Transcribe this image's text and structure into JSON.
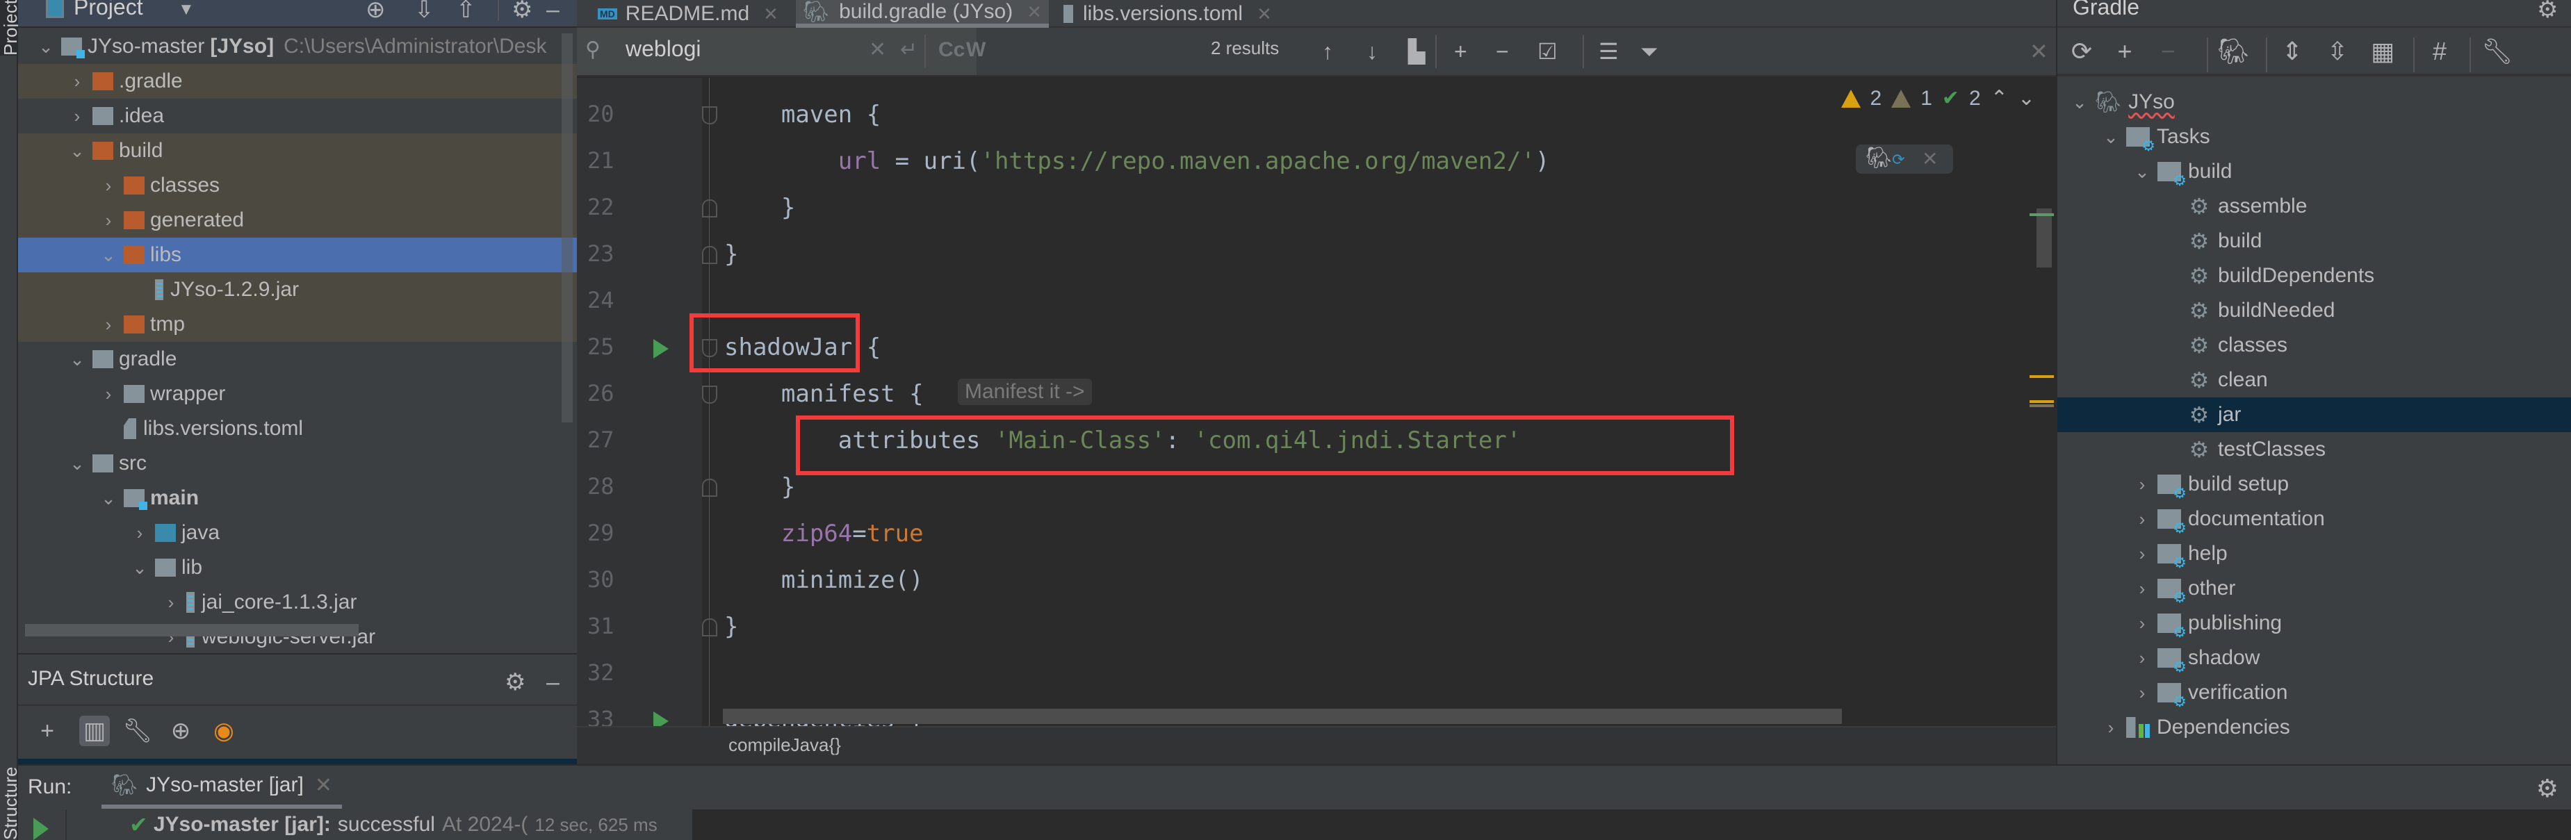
{
  "left_strip": {
    "project_label": "Project",
    "structure_label": "Structure"
  },
  "project_panel": {
    "title": "Project",
    "tree": [
      {
        "label": "JYso-master",
        "bold_suffix": "[JYso]",
        "path": "C:\\Users\\Administrator\\Desk",
        "depth": 0,
        "expanded": true,
        "icon": "module-folder"
      },
      {
        "label": ".gradle",
        "depth": 1,
        "expanded": false,
        "icon": "excluded-folder",
        "excluded": true
      },
      {
        "label": ".idea",
        "depth": 1,
        "expanded": false,
        "icon": "folder"
      },
      {
        "label": "build",
        "depth": 1,
        "expanded": true,
        "icon": "excluded-folder",
        "excluded": true
      },
      {
        "label": "classes",
        "depth": 2,
        "expanded": false,
        "icon": "excluded-folder",
        "excluded": true
      },
      {
        "label": "generated",
        "depth": 2,
        "expanded": false,
        "icon": "excluded-folder",
        "excluded": true
      },
      {
        "label": "libs",
        "depth": 2,
        "expanded": true,
        "icon": "excluded-folder",
        "selected": true
      },
      {
        "label": "JYso-1.2.9.jar",
        "depth": 3,
        "icon": "jar",
        "excluded": true
      },
      {
        "label": "tmp",
        "depth": 2,
        "expanded": false,
        "icon": "excluded-folder",
        "excluded": true
      },
      {
        "label": "gradle",
        "depth": 1,
        "expanded": true,
        "icon": "folder"
      },
      {
        "label": "wrapper",
        "depth": 2,
        "expanded": false,
        "icon": "folder"
      },
      {
        "label": "libs.versions.toml",
        "depth": 2,
        "icon": "file"
      },
      {
        "label": "src",
        "depth": 1,
        "expanded": true,
        "icon": "folder"
      },
      {
        "label": "main",
        "depth": 2,
        "expanded": true,
        "icon": "module-folder",
        "bold": true
      },
      {
        "label": "java",
        "depth": 3,
        "expanded": false,
        "icon": "source-folder"
      },
      {
        "label": "lib",
        "depth": 3,
        "expanded": true,
        "icon": "folder"
      },
      {
        "label": "jai_core-1.1.3.jar",
        "depth": 4,
        "expanded": false,
        "icon": "jar"
      },
      {
        "label": "weblogic-server.jar",
        "depth": 4,
        "expanded": false,
        "icon": "jar"
      }
    ]
  },
  "jpa_panel": {
    "title": "JPA Structure"
  },
  "editor": {
    "tabs": [
      {
        "label": "README.md",
        "icon": "markdown-icon",
        "active": false
      },
      {
        "label": "build.gradle (JYso)",
        "icon": "gradle-icon",
        "active": true
      },
      {
        "label": "libs.versions.toml",
        "icon": "file-icon",
        "active": false
      }
    ],
    "find": {
      "query": "weblogi",
      "result_count": "2 results",
      "match_case": "Cc",
      "words": "W",
      "regex": ".*"
    },
    "inspections": {
      "warnings": "2",
      "weak_warnings": "1",
      "typos": "2"
    },
    "lines": [
      {
        "no": "20",
        "parts": [
          [
            "plain",
            "    maven {"
          ]
        ]
      },
      {
        "no": "21",
        "parts": [
          [
            "plain",
            "        "
          ],
          [
            "prop",
            "url"
          ],
          [
            "plain",
            " = uri("
          ],
          [
            "str",
            "'https://repo.maven.apache.org/maven2/'"
          ],
          [
            "plain",
            ")"
          ]
        ]
      },
      {
        "no": "22",
        "parts": [
          [
            "plain",
            "    }"
          ]
        ]
      },
      {
        "no": "23",
        "parts": [
          [
            "plain",
            "}"
          ]
        ]
      },
      {
        "no": "24",
        "parts": []
      },
      {
        "no": "25",
        "parts": [
          [
            "plain",
            "shadowJar {"
          ]
        ]
      },
      {
        "no": "26",
        "parts": [
          [
            "plain",
            "    manifest {"
          ]
        ]
      },
      {
        "no": "27",
        "parts": [
          [
            "plain",
            "        attributes "
          ],
          [
            "str",
            "'Main-Class'"
          ],
          [
            "plain",
            ": "
          ],
          [
            "str",
            "'com.qi4l.jndi.Starter'"
          ]
        ]
      },
      {
        "no": "28",
        "parts": [
          [
            "plain",
            "    }"
          ]
        ]
      },
      {
        "no": "29",
        "parts": [
          [
            "plain",
            "    "
          ],
          [
            "prop",
            "zip64"
          ],
          [
            "plain",
            "="
          ],
          [
            "kw",
            "true"
          ]
        ]
      },
      {
        "no": "30",
        "parts": [
          [
            "plain",
            "    minimize()"
          ]
        ]
      },
      {
        "no": "31",
        "parts": [
          [
            "plain",
            "}"
          ]
        ]
      },
      {
        "no": "32",
        "parts": []
      },
      {
        "no": "33",
        "parts": [
          [
            "plain",
            "dependencies {"
          ]
        ]
      }
    ],
    "inlay_hint": "Manifest it ->",
    "breadcrumb": "compileJava{}"
  },
  "gradle_panel": {
    "title": "Gradle",
    "tree": [
      {
        "label": "JYso",
        "depth": 0,
        "expanded": true,
        "icon": "elephant",
        "squiggle": true
      },
      {
        "label": "Tasks",
        "depth": 1,
        "expanded": true,
        "icon": "task-folder"
      },
      {
        "label": "build",
        "depth": 2,
        "expanded": true,
        "icon": "task-folder"
      },
      {
        "label": "assemble",
        "depth": 3,
        "icon": "gear"
      },
      {
        "label": "build",
        "depth": 3,
        "icon": "gear"
      },
      {
        "label": "buildDependents",
        "depth": 3,
        "icon": "gear"
      },
      {
        "label": "buildNeeded",
        "depth": 3,
        "icon": "gear"
      },
      {
        "label": "classes",
        "depth": 3,
        "icon": "gear"
      },
      {
        "label": "clean",
        "depth": 3,
        "icon": "gear"
      },
      {
        "label": "jar",
        "depth": 3,
        "icon": "gear",
        "selected": true
      },
      {
        "label": "testClasses",
        "depth": 3,
        "icon": "gear"
      },
      {
        "label": "build setup",
        "depth": 2,
        "expanded": false,
        "icon": "task-folder"
      },
      {
        "label": "documentation",
        "depth": 2,
        "expanded": false,
        "icon": "task-folder"
      },
      {
        "label": "help",
        "depth": 2,
        "expanded": false,
        "icon": "task-folder"
      },
      {
        "label": "other",
        "depth": 2,
        "expanded": false,
        "icon": "task-folder"
      },
      {
        "label": "publishing",
        "depth": 2,
        "expanded": false,
        "icon": "task-folder"
      },
      {
        "label": "shadow",
        "depth": 2,
        "expanded": false,
        "icon": "task-folder"
      },
      {
        "label": "verification",
        "depth": 2,
        "expanded": false,
        "icon": "task-folder"
      },
      {
        "label": "Dependencies",
        "depth": 1,
        "expanded": false,
        "icon": "dependencies"
      }
    ]
  },
  "run_panel": {
    "label": "Run:",
    "tab": "JYso-master [jar]",
    "result_name": "JYso-master [jar]:",
    "result_status": "successful",
    "result_time": "At 2024-(",
    "duration": "12 sec, 625 ms"
  },
  "colors": {
    "accent_selection": "#4b6eaf",
    "red_highlight": "#f23c3c",
    "success": "#499c54",
    "warning": "#d9a012"
  }
}
